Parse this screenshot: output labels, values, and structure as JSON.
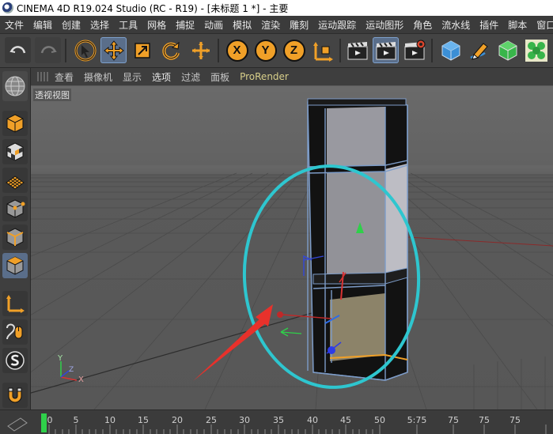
{
  "window": {
    "title": "CINEMA 4D R19.024 Studio (RC - R19) - [未标题 1 *] - 主要"
  },
  "menu": [
    "文件",
    "编辑",
    "创建",
    "选择",
    "工具",
    "网格",
    "捕捉",
    "动画",
    "模拟",
    "渲染",
    "雕刻",
    "运动跟踪",
    "运动图形",
    "角色",
    "流水线",
    "插件",
    "脚本",
    "窗口"
  ],
  "toolbar": {
    "axis_x": "X",
    "axis_y": "Y",
    "axis_z": "Z"
  },
  "viewport_menu": [
    "查看",
    "摄像机",
    "显示",
    "选项",
    "过滤",
    "面板",
    "ProRender"
  ],
  "viewport_menu_selected": "选项",
  "viewport": {
    "label": "透视视图",
    "axis_y": "Y",
    "axis_x": "X",
    "axis_z": "Z"
  },
  "timeline": {
    "ticks": [
      "0",
      "5",
      "10",
      "15",
      "20",
      "25",
      "30",
      "35",
      "40",
      "45",
      "50",
      "5:75",
      "75",
      "75",
      "75"
    ]
  },
  "colors": {
    "accent": "#f0a028",
    "highlight_ellipse": "#2ec6cf",
    "arrow": "#e8312b"
  }
}
